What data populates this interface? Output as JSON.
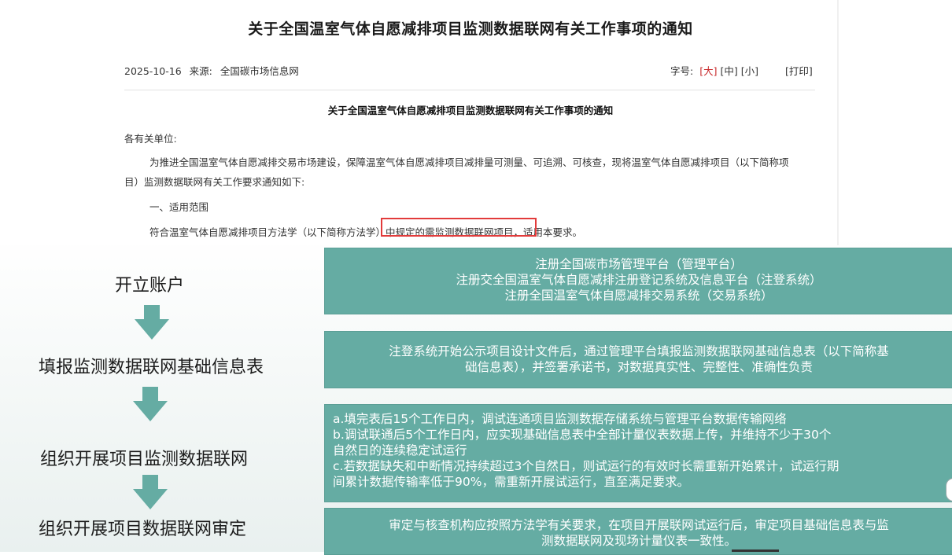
{
  "article": {
    "title": "关于全国温室气体自愿减排项目监测数据联网有关工作事项的通知",
    "date": "2025-10-16",
    "source_label": "来源:",
    "source": "全国碳市场信息网",
    "font_size_label": "字号:",
    "font_large": "[大]",
    "font_medium": "[中]",
    "font_small": "[小]",
    "print": "[打印]",
    "sub_title": "关于全国温室气体自愿减排项目监测数据联网有关工作事项的通知",
    "salutation": "各有关单位:",
    "para1_line1": "为推进全国温室气体自愿减排交易市场建设，保障温室气体自愿减排项目减排量可测量、可追溯、可核查，现将温室气体自愿减排项目（以下简称项",
    "para1_line2": "目）监测数据联网有关工作要求通知如下:",
    "section1": "一、适用范围",
    "para2": "符合温室气体自愿减排项目方法学（以下简称方法学）中规定的需监测数据联网项目，适用本要求。"
  },
  "flow": {
    "steps": [
      {
        "label": "开立账户",
        "lines": [
          "注册全国碳市场管理平台（管理平台）",
          "注册交全国温室气体自愿减排注册登记系统及信息平台（注登系统）",
          "注册全国温室气体自愿减排交易系统（交易系统）"
        ]
      },
      {
        "label": "填报监测数据联网基础信息表",
        "lines": [
          "注登系统开始公示项目设计文件后，通过管理平台填报监测数据联网基础信息表（以下简称基",
          "础信息表），并签署承诺书，对数据真实性、完整性、准确性负责"
        ]
      },
      {
        "label": "组织开展项目监测数据联网",
        "lines": [
          "a.填完表后15个工作日内，调试连通项目监测数据存储系统与管理平台数据传输网络",
          "b.调试联通后5个工作日内，应实现基础信息表中全部计量仪表数据上传，并维持不少于30个",
          "自然日的连续稳定试运行",
          "c.若数据缺失和中断情况持续超过3个自然日，则试运行的有效时长需重新开始累计，试运行期",
          "间累计数据传输率低于90%，需重新开展试运行，直至满足要求。"
        ]
      },
      {
        "label": "组织开展项目数据联网审定",
        "lines": [
          "审定与核查机构应按照方法学有关要求，在项目开展联网试运行后，审定项目基础信息表与监",
          "测数据联网及现场计量仪表一致性。"
        ]
      }
    ]
  },
  "colors": {
    "box_fill": "#65aca3",
    "arrow_fill": "#65aca3",
    "highlight_border": "#e23b3b",
    "font_large_color": "#c8292b"
  },
  "icons": {
    "flow_arrow": "down-arrow-icon"
  }
}
